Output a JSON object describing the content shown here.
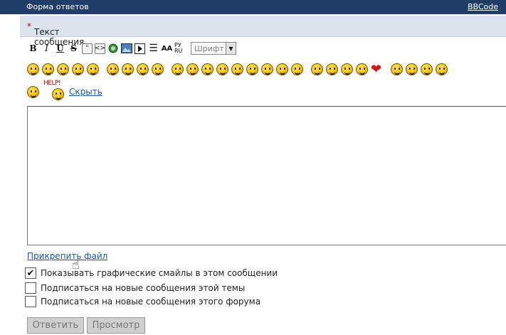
{
  "header": {
    "title": "Форма ответов",
    "bbcode_link": "BBCode"
  },
  "message_label": {
    "text": "Текст сообщения",
    "required_mark": "*"
  },
  "toolbar": {
    "buttons": [
      {
        "name": "bold",
        "glyph": "B"
      },
      {
        "name": "italic",
        "glyph": "I"
      },
      {
        "name": "underline",
        "glyph": "U"
      },
      {
        "name": "strike",
        "glyph": "S"
      },
      {
        "name": "quote",
        "glyph": "\""
      },
      {
        "name": "code",
        "glyph": "<>"
      },
      {
        "name": "link",
        "glyph": "@"
      },
      {
        "name": "image",
        "glyph": ""
      },
      {
        "name": "video",
        "glyph": "▶"
      },
      {
        "name": "list",
        "glyph": "☰"
      },
      {
        "name": "font-size",
        "glyph": "AA"
      },
      {
        "name": "translit",
        "glyph": "РУ RU"
      }
    ],
    "font_select": "Шрифт"
  },
  "smileys": {
    "row_count": 27
  },
  "smileys2": {
    "help_text": "HELP!"
  },
  "hide_link": "Скрыть",
  "attach_link": "Прикрепить файл",
  "options": [
    {
      "label": "Показывать графические смайлы в этом сообщении",
      "checked": true
    },
    {
      "label": "Подписаться на новые сообщения этой темы",
      "checked": false
    },
    {
      "label": "Подписаться на новые сообщения этого форума",
      "checked": false
    }
  ],
  "buttons": {
    "submit": "Ответить",
    "preview": "Просмотр"
  },
  "colors": {
    "header_bg": "#1f3d66",
    "link": "#1a56a8",
    "required": "#cc0000"
  }
}
